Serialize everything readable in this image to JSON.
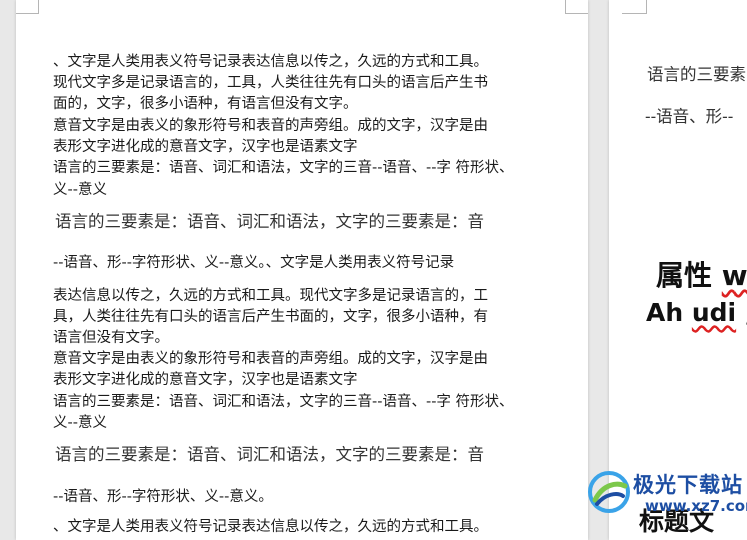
{
  "page1": {
    "lines": [
      "、文字是人类用表义符号记录表达信息以传之，久远的方式和工具。",
      "现代文字多是记录语言的，工具，人类往往先有口头的语言后产生书",
      "面的，文字，很多小语种，有语言但没有文字。",
      "意音文字是由表义的象形符号和表音的声旁组。成的文字，汉字是由",
      "表形文字进化成的意音文字，汉字也是语素文字",
      "语言的三要素是：语音、词汇和语法，文字的三音--语音、--字  符形状、",
      "义--意义",
      "语言的三要素是：语音、词汇和语法，文字的三要素是：音",
      "--语音、形--字符形状、义--意义。、文字是人类用表义符号记录",
      "表达信息以传之，久远的方式和工具。现代文字多是记录语言的，工",
      "具，人类往往先有口头的语言后产生书面的，文字，很多小语种，有",
      "语言但没有文字。",
      "意音文字是由表义的象形符号和表音的声旁组。成的文字，汉字是由",
      "表形文字进化成的意音文字，汉字也是语素文字",
      "语言的三要素是：语音、词汇和语法，文字的三音--语音、--字  符形状、",
      "义--意义",
      "语言的三要素是：语音、词汇和语法，文字的三要素是：音",
      "--语音、形--字符形状、义--意义。",
      "、文字是人类用表义符号记录表达信息以传之，久远的方式和工具。"
    ]
  },
  "page2": {
    "line1": "语言的三要素",
    "line2": "--语音、形--",
    "heading_prefix": "属性 ",
    "heading_squiggle": "w",
    "subheading_prefix": "Ah ",
    "subheading_squiggle": "udi",
    "subheading_suffix": " ,",
    "last_line": "标题文"
  },
  "watermark": {
    "title": "极光下载站",
    "url": "www.xz7.com",
    "logo_icon": "aurora-logo-icon"
  }
}
